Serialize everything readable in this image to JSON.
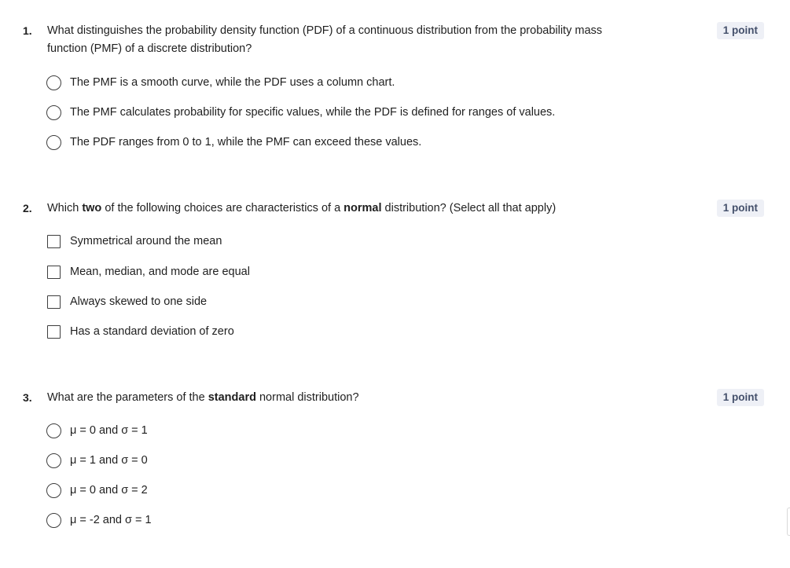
{
  "questions": [
    {
      "number": "1.",
      "text_parts": [
        "What distinguishes the probability density function (PDF) of a continuous distribution from the probability mass function (PMF) of a discrete distribution?"
      ],
      "points": "1 point",
      "input_type": "radio",
      "options": [
        "The PMF is a smooth curve, while the PDF uses a column chart.",
        "The PMF calculates probability for specific values, while the PDF is defined for ranges of values.",
        "The PDF ranges from 0 to 1, while the PMF can exceed these values."
      ]
    },
    {
      "number": "2.",
      "text_before": "Which ",
      "text_bold1": "two",
      "text_mid": " of the following choices are characteristics of a ",
      "text_bold2": "normal",
      "text_after": " distribution? (Select all that apply)",
      "points": "1 point",
      "input_type": "checkbox",
      "options": [
        "Symmetrical around the mean",
        "Mean, median, and mode are equal",
        "Always skewed to one side",
        "Has a standard deviation of zero"
      ]
    },
    {
      "number": "3.",
      "text_before": "What are the parameters of the ",
      "text_bold": "standard",
      "text_after": " normal distribution?",
      "points": "1 point",
      "input_type": "radio",
      "options": [
        "μ = 0 and σ = 1",
        "μ = 1 and σ = 0",
        "μ = 0 and σ = 2",
        "μ = -2 and σ = 1"
      ]
    }
  ],
  "colors": {
    "text": "#1f1f1f",
    "badge_bg": "#eef0f6",
    "badge_text": "#44506b",
    "control_border": "#3d3d3d"
  }
}
